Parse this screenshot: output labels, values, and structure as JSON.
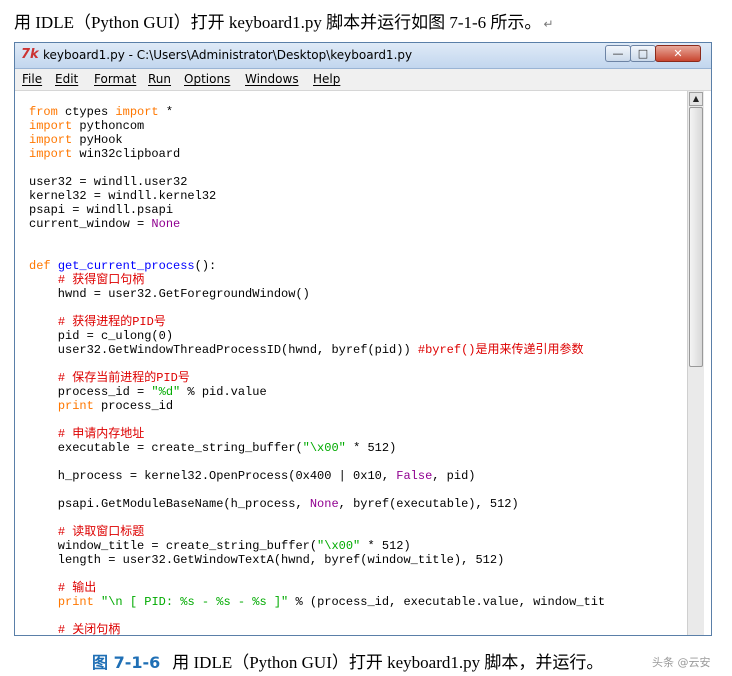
{
  "caption_top": "用 IDLE（Python GUI）打开 keyboard1.py 脚本并运行如图 7-1-6 所示。",
  "caption_top_return": "↵",
  "window": {
    "icon": "7k",
    "title": "keyboard1.py - C:\\Users\\Administrator\\Desktop\\keyboard1.py",
    "minimize_label": "—",
    "maximize_label": "□",
    "close_label": "✕"
  },
  "menu": [
    "File",
    "Edit",
    "Format",
    "Run",
    "Options",
    "Windows",
    "Help"
  ],
  "code_lines": [
    [
      {
        "t": "from",
        "c": "kw"
      },
      {
        "t": " ctypes "
      },
      {
        "t": "import",
        "c": "kw"
      },
      {
        "t": " *"
      }
    ],
    [
      {
        "t": "import",
        "c": "kw"
      },
      {
        "t": " pythoncom"
      }
    ],
    [
      {
        "t": "import",
        "c": "kw"
      },
      {
        "t": " pyHook"
      }
    ],
    [
      {
        "t": "import",
        "c": "kw"
      },
      {
        "t": " win32clipboard"
      }
    ],
    [],
    [
      {
        "t": "user32 = windll.user32"
      }
    ],
    [
      {
        "t": "kernel32 = windll.kernel32"
      }
    ],
    [
      {
        "t": "psapi = windll.psapi"
      }
    ],
    [
      {
        "t": "current_window = "
      },
      {
        "t": "None",
        "c": "no"
      }
    ],
    [],
    [],
    [
      {
        "t": "def",
        "c": "kw"
      },
      {
        "t": " "
      },
      {
        "t": "get_current_process",
        "c": "fn"
      },
      {
        "t": "():"
      }
    ],
    [
      {
        "t": "    "
      },
      {
        "t": "# 获得窗口句柄",
        "c": "cm"
      }
    ],
    [
      {
        "t": "    hwnd = user32.GetForegroundWindow()"
      }
    ],
    [],
    [
      {
        "t": "    "
      },
      {
        "t": "# 获得进程的PID号",
        "c": "cm"
      }
    ],
    [
      {
        "t": "    pid = c_ulong(0)"
      }
    ],
    [
      {
        "t": "    user32.GetWindowThreadProcessID(hwnd, byref(pid)) "
      },
      {
        "t": "#byref()是用来传递引用参数",
        "c": "cm"
      }
    ],
    [],
    [
      {
        "t": "    "
      },
      {
        "t": "# 保存当前进程的PID号",
        "c": "cm"
      }
    ],
    [
      {
        "t": "    process_id = "
      },
      {
        "t": "\"%d\"",
        "c": "st"
      },
      {
        "t": " % pid.value"
      }
    ],
    [
      {
        "t": "    "
      },
      {
        "t": "print",
        "c": "kw"
      },
      {
        "t": " process_id"
      }
    ],
    [],
    [
      {
        "t": "    "
      },
      {
        "t": "# 申请内存地址",
        "c": "cm"
      }
    ],
    [
      {
        "t": "    executable = create_string_buffer("
      },
      {
        "t": "\"\\x00\"",
        "c": "st"
      },
      {
        "t": " * 512)"
      }
    ],
    [],
    [
      {
        "t": "    h_process = kernel32.OpenProcess(0x400 | 0x10, "
      },
      {
        "t": "False",
        "c": "no"
      },
      {
        "t": ", pid)"
      }
    ],
    [],
    [
      {
        "t": "    psapi.GetModuleBaseName(h_process, "
      },
      {
        "t": "None",
        "c": "no"
      },
      {
        "t": ", byref(executable), 512)"
      }
    ],
    [],
    [
      {
        "t": "    "
      },
      {
        "t": "# 读取窗口标题",
        "c": "cm"
      }
    ],
    [
      {
        "t": "    window_title = create_string_buffer("
      },
      {
        "t": "\"\\x00\"",
        "c": "st"
      },
      {
        "t": " * 512)"
      }
    ],
    [
      {
        "t": "    length = user32.GetWindowTextA(hwnd, byref(window_title), 512)"
      }
    ],
    [],
    [
      {
        "t": "    "
      },
      {
        "t": "# 输出",
        "c": "cm"
      }
    ],
    [
      {
        "t": "    "
      },
      {
        "t": "print",
        "c": "kw"
      },
      {
        "t": " "
      },
      {
        "t": "\"\\n [ PID: %s - %s - %s ]\"",
        "c": "st"
      },
      {
        "t": " % (process_id, executable.value, window_tit"
      }
    ],
    [],
    [
      {
        "t": "    "
      },
      {
        "t": "# 关闭句柄",
        "c": "cm"
      }
    ]
  ],
  "caption_bottom": {
    "figure_number": "图 7-1-6",
    "text": "用 IDLE（Python GUI）打开 keyboard1.py 脚本，并运行。"
  },
  "watermark": "头条 @云安",
  "colors": {
    "keyword": "#ff7700",
    "function_name": "#0000ff",
    "comment": "#dd0000",
    "string": "#00aa00",
    "constant": "#900090",
    "figure_number": "#1f6fb5"
  }
}
